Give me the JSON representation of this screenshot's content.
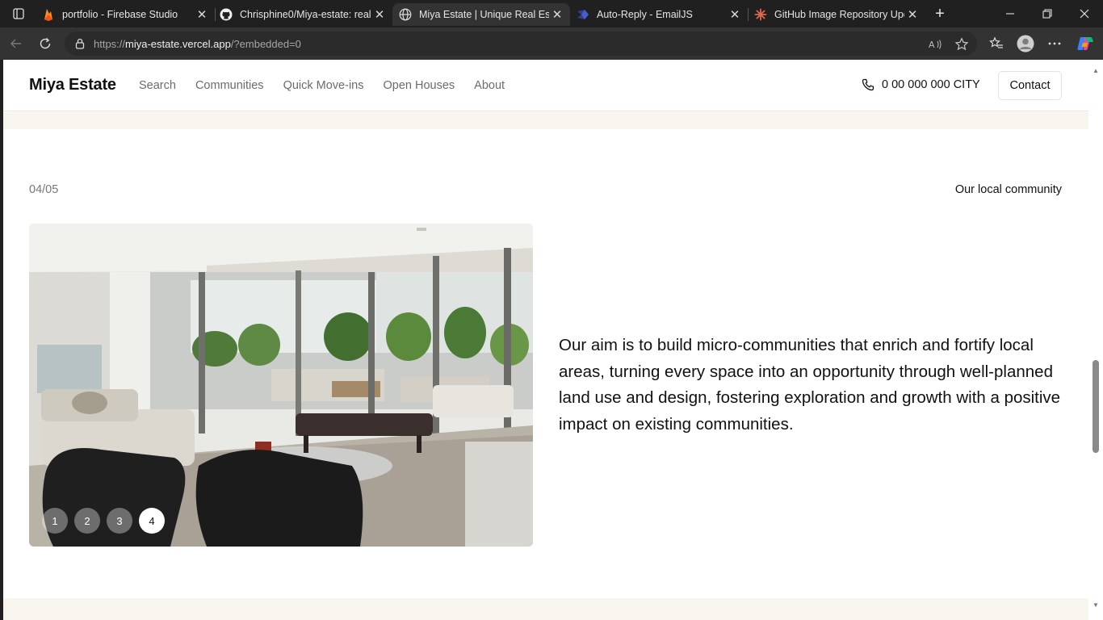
{
  "browser": {
    "tabs": [
      {
        "title": "portfolio - Firebase Studio",
        "icon": "firebase-icon",
        "active": false
      },
      {
        "title": "Chrisphine0/Miya-estate: real",
        "icon": "github-icon",
        "active": false
      },
      {
        "title": "Miya Estate | Unique Real Esta",
        "icon": "globe-icon",
        "active": true
      },
      {
        "title": "Auto-Reply - EmailJS",
        "icon": "emailjs-icon",
        "active": false
      },
      {
        "title": "GitHub Image Repository Upd",
        "icon": "claude-icon",
        "active": false
      }
    ],
    "url_prefix": "https://",
    "url_host": "miya-estate.vercel.app",
    "url_path": "/?embedded=0"
  },
  "site": {
    "logo": "Miya Estate",
    "nav": [
      "Search",
      "Communities",
      "Quick Move-ins",
      "Open Houses",
      "About"
    ],
    "phone": "0 00 000 000 CITY",
    "contact_label": "Contact"
  },
  "section": {
    "counter": "04/05",
    "label": "Our local community",
    "statement": "Our aim is to build micro-communities that enrich and fortify local areas, turning every space into an opportunity through well-planned land use and design, fostering exploration and growth with a positive impact on existing communities.",
    "slides": [
      "1",
      "2",
      "3",
      "4"
    ],
    "active_slide": 4
  },
  "colors": {
    "accent_beige": "#f8f4ee",
    "chrome_dark": "#202020"
  }
}
